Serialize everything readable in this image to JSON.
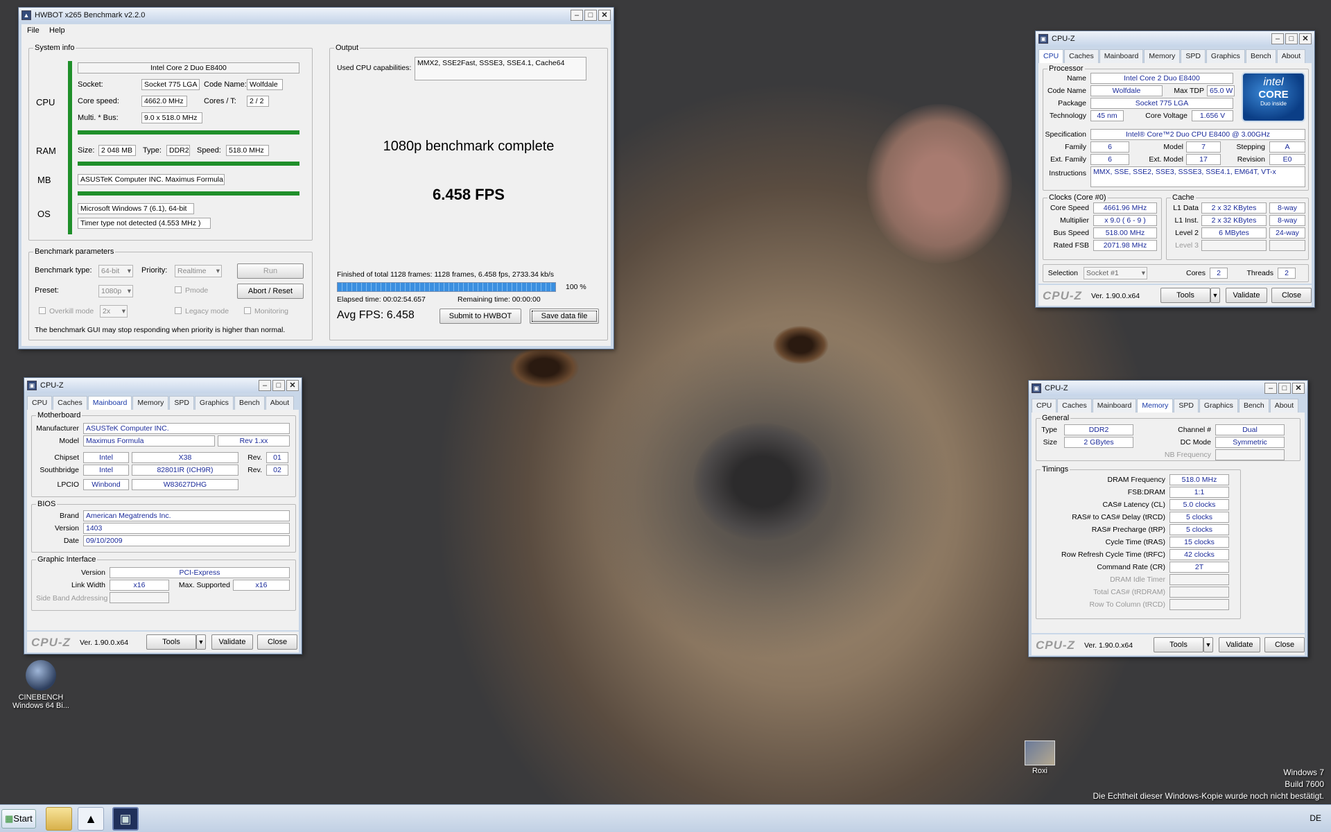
{
  "hwbot": {
    "title": "HWBOT x265 Benchmark v2.2.0",
    "menu": [
      "File",
      "Help"
    ],
    "system_info": {
      "label": "System info",
      "cpu_label": "CPU",
      "ram_label": "RAM",
      "mb_label": "MB",
      "os_label": "OS",
      "cpu_name": "Intel Core 2 Duo E8400",
      "socket_label": "Socket:",
      "socket": "Socket 775 LGA",
      "codename_label": "Code Name:",
      "codename": "Wolfdale",
      "core_speed_label": "Core speed:",
      "core_speed": "4662.0 MHz",
      "cores_label": "Cores / T:",
      "cores": "2 / 2",
      "multi_label": "Multi. * Bus:",
      "multi": "9.0 x 518.0 MHz",
      "size_label": "Size:",
      "ram_size": "2 048 MB",
      "type_label": "Type:",
      "ram_type": "DDR2",
      "speed_label": "Speed:",
      "ram_speed": "518.0 MHz",
      "mb": "ASUSTeK Computer INC. Maximus Formula",
      "os": "Microsoft Windows 7 (6.1), 64-bit",
      "timer": "Timer type not detected (4.553 MHz )"
    },
    "params": {
      "label": "Benchmark parameters",
      "bench_type_label": "Benchmark type:",
      "bench_type": "64-bit",
      "priority_label": "Priority:",
      "priority": "Realtime",
      "run": "Run",
      "preset_label": "Preset:",
      "preset": "1080p",
      "pmode": "Pmode",
      "abort": "Abort / Reset",
      "overkill": "Overkill mode",
      "overkill_val": "2x",
      "legacy": "Legacy mode",
      "monitoring": "Monitoring",
      "warning": "The benchmark GUI may stop responding when priority is higher than normal."
    },
    "output": {
      "label": "Output",
      "caps_label": "Used CPU capabilities:",
      "caps": "MMX2, SSE2Fast, SSSE3, SSE4.1, Cache64",
      "complete": "1080p benchmark complete",
      "fps": "6.458 FPS",
      "finished": "Finished of total 1128 frames: 1128 frames, 6.458 fps,  2733.34 kb/s",
      "progress": 1.0,
      "progress_text": "100 %",
      "elapsed": "Elapsed time: 00:02:54.657",
      "remaining": "Remaining time: 00:00:00",
      "avg": "Avg FPS: 6.458",
      "submit": "Submit to HWBOT",
      "save": "Save data file"
    }
  },
  "cpuz_tabs": [
    "CPU",
    "Caches",
    "Mainboard",
    "Memory",
    "SPD",
    "Graphics",
    "Bench",
    "About"
  ],
  "cpuz_common": {
    "title": "CPU-Z",
    "logo": "CPU-Z",
    "version": "Ver. 1.90.0.x64",
    "tools": "Tools",
    "validate": "Validate",
    "close": "Close"
  },
  "cpuz_cpu": {
    "processor": "Processor",
    "name_label": "Name",
    "name": "Intel Core 2 Duo E8400",
    "codename_label": "Code Name",
    "codename": "Wolfdale",
    "maxtdp_label": "Max TDP",
    "maxtdp": "65.0 W",
    "package_label": "Package",
    "package": "Socket 775 LGA",
    "tech_label": "Technology",
    "tech": "45 nm",
    "voltage_label": "Core Voltage",
    "voltage": "1.656 V",
    "spec_label": "Specification",
    "spec": "Intel® Core™2 Duo CPU    E8400  @ 3.00GHz",
    "family_label": "Family",
    "family": "6",
    "model_label": "Model",
    "model": "7",
    "stepping_label": "Stepping",
    "stepping": "A",
    "extfamily_label": "Ext. Family",
    "extfamily": "6",
    "extmodel_label": "Ext. Model",
    "extmodel": "17",
    "revision_label": "Revision",
    "revision": "E0",
    "instr_label": "Instructions",
    "instr": "MMX, SSE, SSE2, SSE3, SSSE3, SSE4.1, EM64T, VT-x",
    "clocks": "Clocks (Core #0)",
    "corespeed_label": "Core Speed",
    "corespeed": "4661.96 MHz",
    "mult_label": "Multiplier",
    "mult": "x 9.0 ( 6 - 9 )",
    "bus_label": "Bus Speed",
    "bus": "518.00 MHz",
    "fsb_label": "Rated FSB",
    "fsb": "2071.98 MHz",
    "cache": "Cache",
    "l1d_label": "L1 Data",
    "l1d": "2 x 32 KBytes",
    "l1d_way": "8-way",
    "l1i_label": "L1 Inst.",
    "l1i": "2 x 32 KBytes",
    "l1i_way": "8-way",
    "l2_label": "Level 2",
    "l2": "6 MBytes",
    "l2_way": "24-way",
    "l3_label": "Level 3",
    "selection_label": "Selection",
    "selection": "Socket #1",
    "cores_label": "Cores",
    "cores": "2",
    "threads_label": "Threads",
    "threads": "2",
    "intel_logo": "intel",
    "intel_core": "CORE",
    "intel_sub": "Duo",
    "intel_inside": "inside"
  },
  "cpuz_mb": {
    "motherboard": "Motherboard",
    "manu_label": "Manufacturer",
    "manu": "ASUSTeK Computer INC.",
    "model_label": "Model",
    "model": "Maximus Formula",
    "rev": "Rev 1.xx",
    "chipset_label": "Chipset",
    "chipset_v": "Intel",
    "chipset": "X38",
    "rev_label": "Rev.",
    "chipset_rev": "01",
    "south_label": "Southbridge",
    "south_v": "Intel",
    "south": "82801IR (ICH9R)",
    "south_rev": "02",
    "lpcio_label": "LPCIO",
    "lpcio_v": "Winbond",
    "lpcio": "W83627DHG",
    "bios": "BIOS",
    "brand_label": "Brand",
    "brand": "American Megatrends Inc.",
    "version_label": "Version",
    "version": "1403",
    "date_label": "Date",
    "date": "09/10/2009",
    "gi": "Graphic Interface",
    "gi_version_label": "Version",
    "gi_version": "PCI-Express",
    "link_label": "Link Width",
    "link": "x16",
    "maxsup_label": "Max. Supported",
    "maxsup": "x16",
    "sideband_label": "Side Band Addressing"
  },
  "cpuz_mem": {
    "general": "General",
    "type_label": "Type",
    "type": "DDR2",
    "channel_label": "Channel #",
    "channel": "Dual",
    "size_label": "Size",
    "size": "2 GBytes",
    "dc_label": "DC Mode",
    "dc": "Symmetric",
    "nb_label": "NB Frequency",
    "timings": "Timings",
    "rows": [
      {
        "label": "DRAM Frequency",
        "value": "518.0 MHz"
      },
      {
        "label": "FSB:DRAM",
        "value": "1:1"
      },
      {
        "label": "CAS# Latency (CL)",
        "value": "5.0 clocks"
      },
      {
        "label": "RAS# to CAS# Delay (tRCD)",
        "value": "5 clocks"
      },
      {
        "label": "RAS# Precharge (tRP)",
        "value": "5 clocks"
      },
      {
        "label": "Cycle Time (tRAS)",
        "value": "15 clocks"
      },
      {
        "label": "Row Refresh Cycle Time (tRFC)",
        "value": "42 clocks"
      },
      {
        "label": "Command Rate (CR)",
        "value": "2T"
      },
      {
        "label": "DRAM Idle Timer",
        "value": ""
      },
      {
        "label": "Total CAS# (tRDRAM)",
        "value": ""
      },
      {
        "label": "Row To Column (tRCD)",
        "value": ""
      }
    ]
  },
  "desktop": {
    "cinebench": "CINEBENCH\nWindows 64 Bi...",
    "roxi": "Roxi",
    "win7": "Windows 7",
    "build": "Build 7600",
    "genuine": "Die Echtheit dieser Windows-Kopie wurde noch nicht bestätigt.",
    "start": "Start",
    "lang": "DE"
  }
}
